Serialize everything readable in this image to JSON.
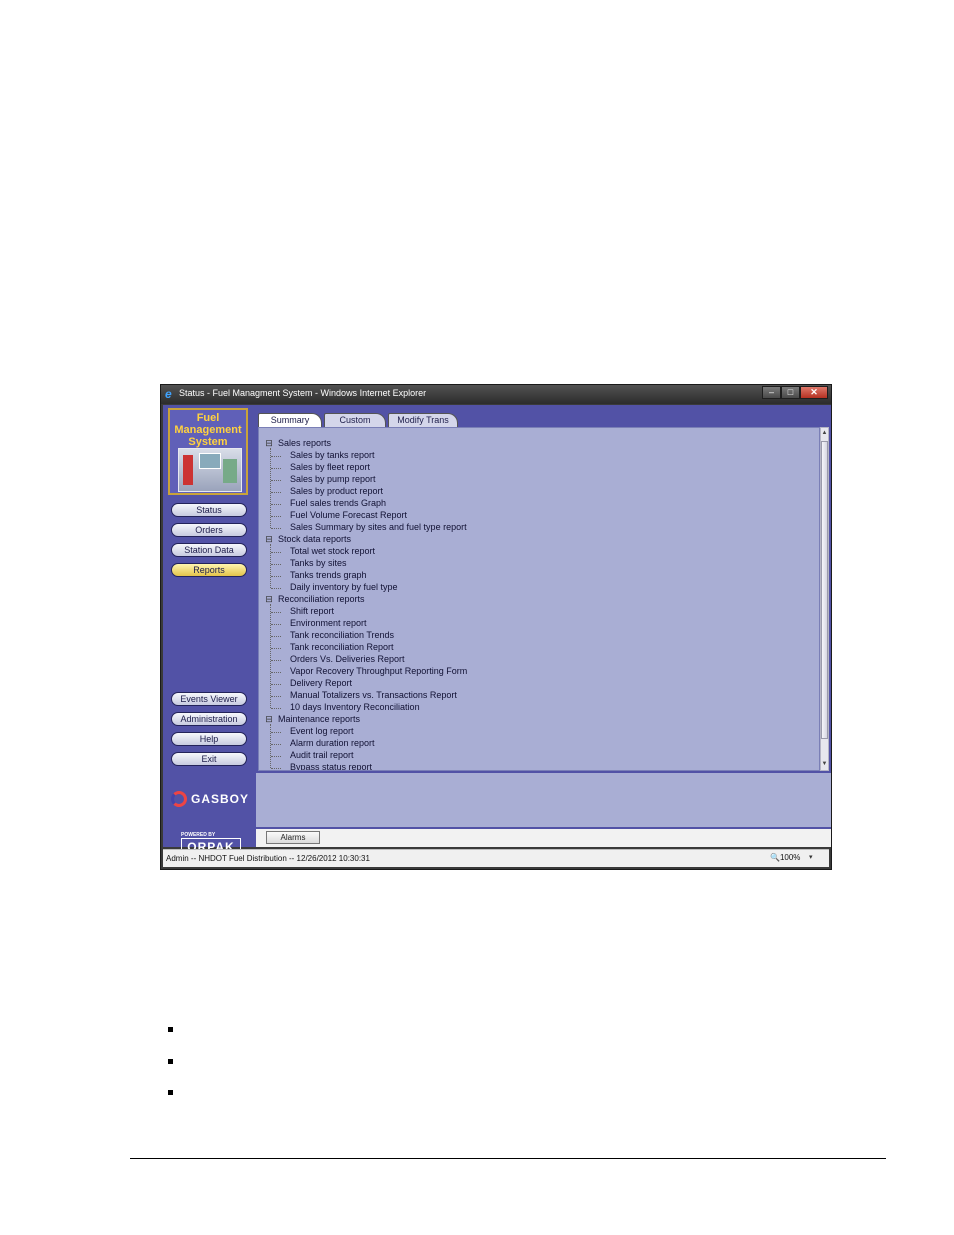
{
  "window": {
    "title": "Status - Fuel Managment System - Windows Internet Explorer",
    "minimize": "–",
    "maximize": "□",
    "close": "✕"
  },
  "sidebar": {
    "logo_lines": [
      "Fuel",
      "Management",
      "System"
    ],
    "nav": [
      {
        "label": "Status"
      },
      {
        "label": "Orders"
      },
      {
        "label": "Station Data"
      },
      {
        "label": "Reports"
      }
    ],
    "bottom_nav": [
      {
        "label": "Events Viewer"
      },
      {
        "label": "Administration"
      },
      {
        "label": "Help"
      },
      {
        "label": "Exit"
      }
    ],
    "brand": "GASBOY",
    "powered_by": "POWERED BY",
    "powered_by_brand": "ORPAK"
  },
  "tabs": [
    {
      "label": "Summary",
      "selected": true
    },
    {
      "label": "Custom",
      "selected": false
    },
    {
      "label": "Modify Trans",
      "selected": false
    }
  ],
  "tree": [
    {
      "label": "Sales reports",
      "children": [
        "Sales by tanks report",
        "Sales by fleet report",
        "Sales by pump report",
        "Sales by product report",
        "Fuel sales trends Graph",
        "Fuel Volume Forecast Report",
        "Sales Summary by sites and fuel type report"
      ]
    },
    {
      "label": "Stock data reports",
      "children": [
        "Total wet stock report",
        "Tanks by sites",
        "Tanks trends graph",
        "Daily inventory by fuel type"
      ]
    },
    {
      "label": "Reconciliation reports",
      "children": [
        "Shift report",
        "Environment report",
        "Tank reconciliation Trends",
        "Tank reconciliation Report",
        "Orders Vs. Deliveries Report",
        "Vapor Recovery Throughput Reporting Form",
        "Delivery Report",
        "Manual Totalizers vs. Transactions Report",
        "10 days Inventory Reconciliation"
      ]
    },
    {
      "label": "Maintenance reports",
      "children": [
        "Event log report",
        "Alarm duration report",
        "Audit trail report",
        "Bypass status report"
      ]
    }
  ],
  "toggle_symbol": "⊟",
  "alarms_button": "Alarms",
  "statusbar": {
    "text": "Admin -- NHDOT Fuel Distribution -- 12/26/2012  10:30:31",
    "zoom": "🔍100%",
    "zoom_arrow": "▾"
  },
  "scroll": {
    "up": "▲",
    "down": "▼"
  },
  "colors": {
    "sidebar": "#5252a6",
    "tree_bg": "#a9aed4",
    "logo_text": "#ffd23f",
    "active_pill": "#e3c34a"
  }
}
